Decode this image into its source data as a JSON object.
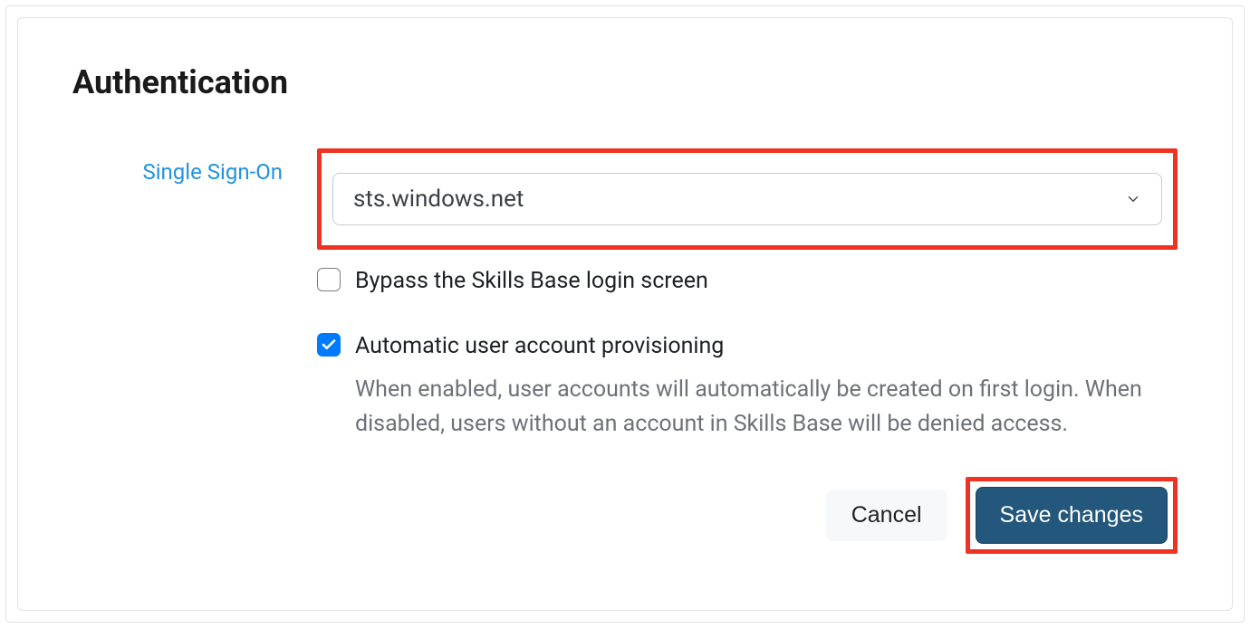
{
  "section": {
    "title": "Authentication"
  },
  "sso": {
    "label": "Single Sign-On",
    "selected": "sts.windows.net"
  },
  "bypass": {
    "label": "Bypass the Skills Base login screen",
    "checked": false
  },
  "autoprov": {
    "label": "Automatic user account provisioning",
    "help": "When enabled, user accounts will automatically be created on first login. When disabled, users without an account in Skills Base will be denied access.",
    "checked": true
  },
  "buttons": {
    "cancel": "Cancel",
    "save": "Save changes"
  }
}
